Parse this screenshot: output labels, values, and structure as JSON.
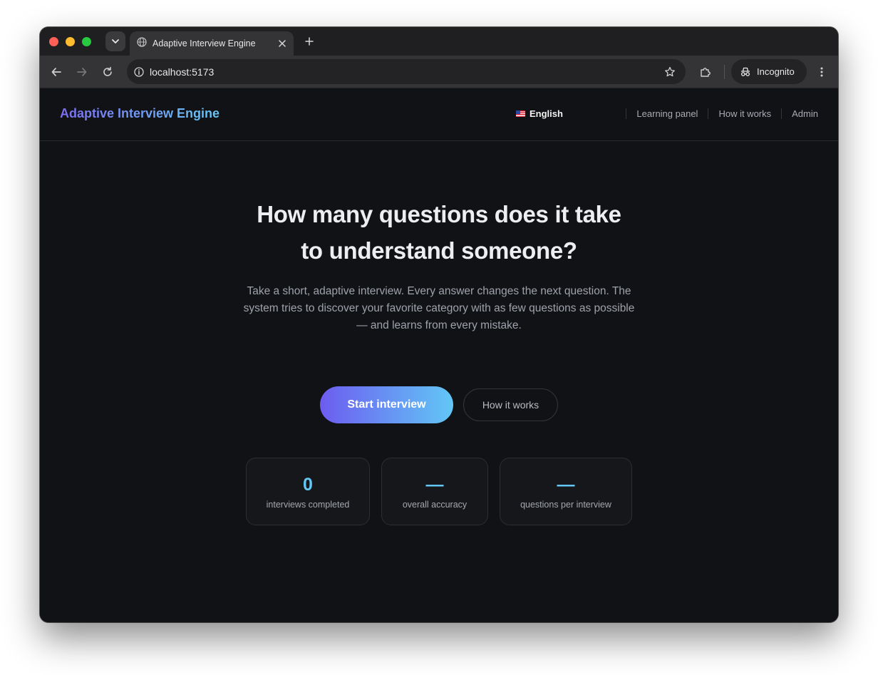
{
  "browser": {
    "tab_title": "Adaptive Interview Engine",
    "url": "localhost:5173",
    "profile_label": "Incognito",
    "icons": [
      "tab-search-icon",
      "globe-icon",
      "close-icon",
      "plus-icon",
      "back-icon",
      "forward-icon",
      "reload-icon",
      "info-icon",
      "star-icon",
      "extensions-icon",
      "incognito-icon",
      "more-icon"
    ]
  },
  "header": {
    "brand": "Adaptive Interview Engine",
    "language": "English",
    "nav": [
      {
        "label": "Learning panel"
      },
      {
        "label": "How it works"
      },
      {
        "label": "Admin"
      }
    ]
  },
  "hero": {
    "title_line1": "How many questions does it take",
    "title_line2": "to understand someone?",
    "subtitle": "Take a short, adaptive interview. Every answer changes the next question. The system tries to discover your favorite category with as few questions as possible — and learns from every mistake.",
    "primary_button": "Start interview",
    "secondary_button": "How it works"
  },
  "stats": [
    {
      "value": "0",
      "label": "interviews completed"
    },
    {
      "value": "—",
      "label": "overall accuracy"
    },
    {
      "value": "—",
      "label": "questions per interview"
    }
  ],
  "colors": {
    "accent_start": "#6c5cf0",
    "accent_end": "#62c7f6",
    "stat_value": "#63c6f4",
    "background": "#111215"
  }
}
